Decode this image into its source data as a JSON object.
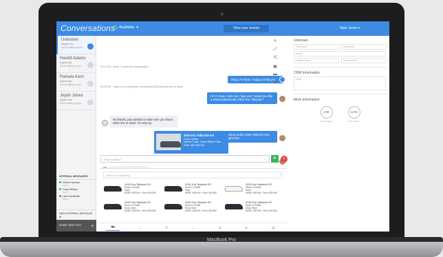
{
  "device": {
    "label": "MacBook Pro"
  },
  "app": {
    "title": "Conversations",
    "status": "Available",
    "view_scores": "View your scores",
    "user": "Nate Jones"
  },
  "sidebar": {
    "conversations": [
      {
        "name": "Unknown",
        "sub": "Inquire Kia",
        "time": "26:02 waiting on you"
      },
      {
        "name": "Harold Adams",
        "sub": "Inquire Kia",
        "time": "08:24 waiting on you"
      },
      {
        "name": "Pamela Kern",
        "sub": "Inquire Kia",
        "time": "08:13 waiting on you"
      },
      {
        "name": "Joydn Jones",
        "sub": "Inquire Kia",
        "time": "09:24 waiting on you"
      }
    ],
    "internal_title": "INTERNAL MESSAGES",
    "internal": [
      {
        "name": "Victor Hanson",
        "sub": "Sent 6"
      },
      {
        "name": "Tripp Mckay",
        "sub": "Sent 6"
      },
      {
        "name": "Lyle Kauffman",
        "sub": "Sent 6"
      }
    ],
    "new_internal": "NEW INTERNAL MESSAGE",
    "start_text": "START NEW TEXT"
  },
  "chat": {
    "sys1": "04:15 PM - Ryan P. joined the conversation",
    "sys2": "04:15 PM - Visitor is on mywebsite.com/vehicles/2020-kia-telluride-ex-white",
    "msg1": "Okay, I'm Ryan. Happy to help you.",
    "msg2": "Hi I'm Ryan. How can I help you? Would you like a virtual walkaround of the new Telluride?",
    "msg3": "No thanks, just wanted to make sure you had a white one in stock. I'll come by",
    "msg4": "Me, I'm looking at this white Telluride from my desk right now.",
    "msg5": "Cool! I'll see ever at lunch",
    "car_card": {
      "title": "2020 Kia Telluride EX",
      "color": "Color: White",
      "interior": "Interior Color: Snow White Pearl",
      "price": "Price: $37,990.00"
    },
    "compose_placeholder": "Start chatting!"
  },
  "inventory": {
    "search_placeholder": "Search for anything",
    "cars": [
      {
        "title": "2020 Kia Telluride EX",
        "l1": "Stock # 123456",
        "l2": "Silver",
        "l3": "MSRP: $39,990 · Price: $34,990"
      },
      {
        "title": "2020 Kia Telluride EX",
        "l1": "Stock # 123456",
        "l2": "Silver",
        "l3": "MSRP: $39,990 · Price: $34,990"
      },
      {
        "title": "2020 Kia Telluride EX",
        "l1": "Stock # 123456",
        "l2": "Silver",
        "l3": "MSRP: $39,990 · Price: $34,990"
      },
      {
        "title": "2020 Kia Telluride EX",
        "l1": "Stock # 123456",
        "l2": "Snow Silver",
        "l3": "MSRP: $39,990 · Price: $34,990"
      },
      {
        "title": "2020 Kia Telluride EX",
        "l1": "Stock # 123456",
        "l2": "Snow Silver",
        "l3": "MSRP: $39,990 · Price: $34,990"
      },
      {
        "title": "2020 Kia Telluride EX",
        "l1": "Stock # 123456",
        "l2": "Snow Silver",
        "l3": "MSRP: $39,990 · Price: $34,990"
      }
    ]
  },
  "crm": {
    "unknown_title": "Unknown",
    "first_name": "First Name",
    "last_name": "Last Name",
    "email": "Email",
    "mobile": "Mobile Phone",
    "home": "Home Phone",
    "crm_title": "CRM Information",
    "notes": "Notes",
    "more_title": "More information",
    "gauge1_value": "4:06",
    "gauge1_label": "Time Chatting",
    "gauge2_value": "12:03",
    "gauge2_label": "Time on Site"
  },
  "colors": {
    "accent": "#3d8be3",
    "send": "#3cb55a",
    "end": "#e14b4b"
  }
}
